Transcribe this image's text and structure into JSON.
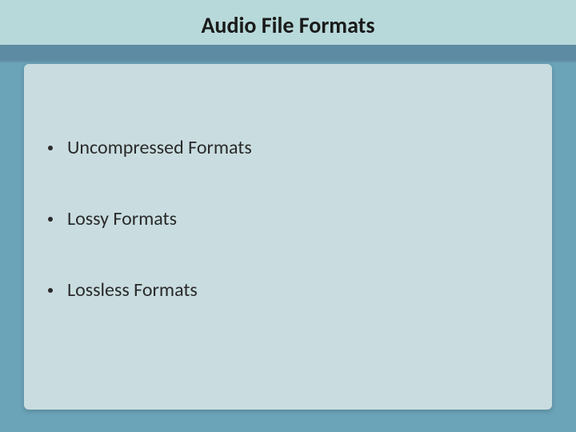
{
  "title": "Audio File Formats",
  "bullets": [
    "Uncompressed Formats",
    "Lossy Formats",
    "Lossless Formats"
  ]
}
